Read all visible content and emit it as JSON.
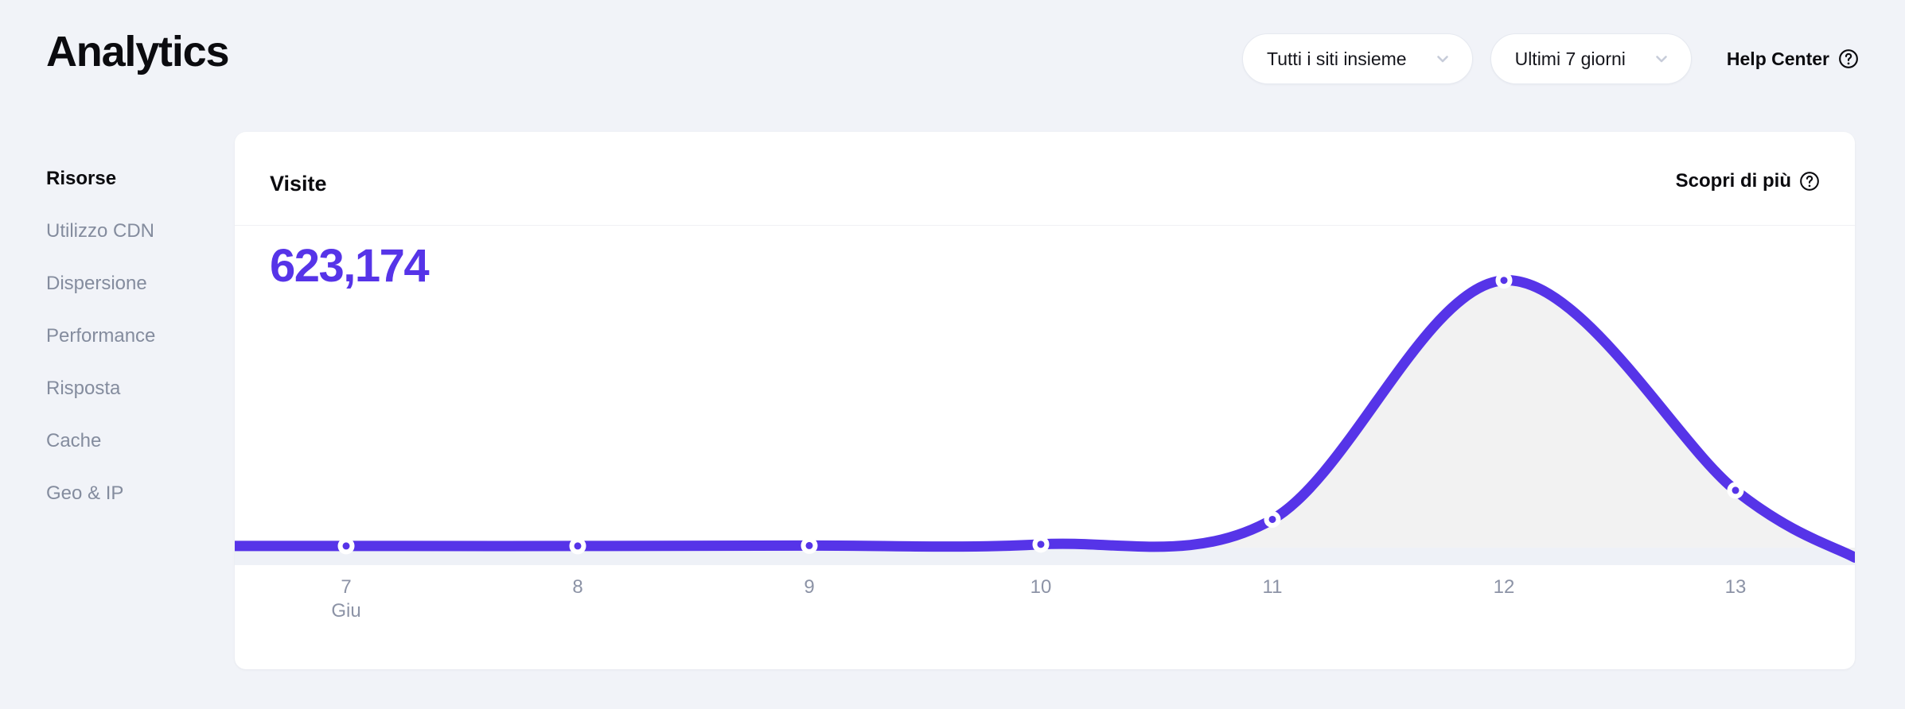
{
  "header": {
    "title": "Analytics",
    "site_filter": {
      "label": "Tutti i siti insieme",
      "icon": "chevron-down-icon"
    },
    "date_filter": {
      "label": "Ultimi 7 giorni",
      "icon": "chevron-down-icon"
    },
    "help_center": {
      "label": "Help Center",
      "icon": "question-circle-icon"
    }
  },
  "sidebar": {
    "items": [
      {
        "label": "Risorse",
        "active": true
      },
      {
        "label": "Utilizzo CDN",
        "active": false
      },
      {
        "label": "Dispersione",
        "active": false
      },
      {
        "label": "Performance",
        "active": false
      },
      {
        "label": "Risposta",
        "active": false
      },
      {
        "label": "Cache",
        "active": false
      },
      {
        "label": "Geo & IP",
        "active": false
      }
    ]
  },
  "card": {
    "title": "Visite",
    "learn_more": {
      "label": "Scopri di più",
      "icon": "question-circle-icon"
    },
    "metric_value": "623,174"
  },
  "colors": {
    "accent": "#5634e8",
    "page_background": "#f1f3f8",
    "card_background": "#ffffff",
    "muted_text": "#848c9e",
    "axis_text": "#8c93a6",
    "area_fill": "#f2f2f2",
    "baseline_band": "#eef1f7"
  },
  "chart_data": {
    "type": "area",
    "title": "Visite",
    "xlabel": "",
    "ylabel": "",
    "grid": false,
    "legend": null,
    "month_label": "Giu",
    "categories": [
      "7",
      "8",
      "9",
      "10",
      "11",
      "12",
      "13"
    ],
    "tick_labels": [
      "7",
      "8",
      "9",
      "10",
      "11",
      "12",
      "13"
    ],
    "x": [
      7,
      8,
      9,
      10,
      11,
      12,
      13
    ],
    "values": [
      2000,
      2000,
      2500,
      4000,
      34000,
      322000,
      69000
    ],
    "series": [
      {
        "name": "Visite",
        "values": [
          2000,
          2000,
          2500,
          4000,
          34000,
          322000,
          69000
        ]
      }
    ],
    "ylim": [
      0,
      360000
    ],
    "total": "623,174",
    "point_markers": true,
    "smooth": true
  }
}
